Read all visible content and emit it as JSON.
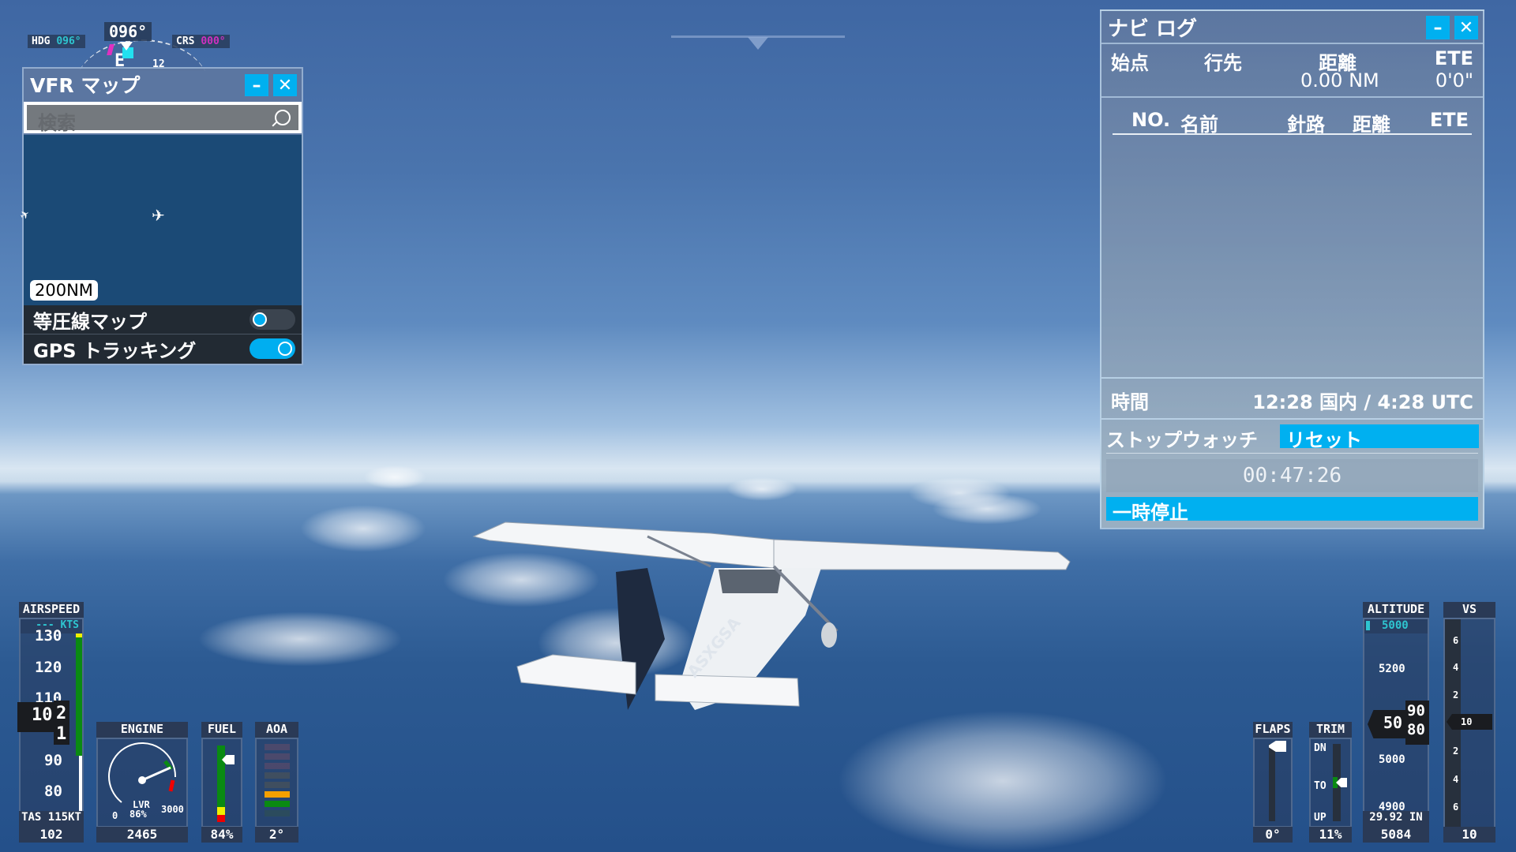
{
  "heading": {
    "hdg_label": "HDG",
    "hdg_value": "096°",
    "current": "096°",
    "crs_label": "CRS",
    "crs_value": "000°",
    "compass_letter": "E",
    "compass_num": "12"
  },
  "vfr_map": {
    "title": "VFR マップ",
    "minimize_icon": "–",
    "close_icon": "✕",
    "search_placeholder": "検索",
    "scale": "200NM",
    "toggles": [
      {
        "label": "等圧線マップ",
        "state": "off"
      },
      {
        "label": "GPS トラッキング",
        "state": "on"
      }
    ]
  },
  "nav_log": {
    "title": "ナビ ログ",
    "minimize_icon": "–",
    "close_icon": "✕",
    "summary": {
      "origin_label": "始点",
      "dest_label": "行先",
      "distance_label": "距離",
      "distance_value": "0.00 NM",
      "ete_label": "ETE",
      "ete_value": "0'0\""
    },
    "columns": [
      "NO.",
      "名前",
      "針路",
      "距離",
      "ETE"
    ],
    "rows": [],
    "time_label": "時間",
    "time_value": "12:28 国内 / 4:28 UTC",
    "stopwatch_label": "ストップウォッチ",
    "reset_label": "リセット",
    "stopwatch_value": "00:47:26",
    "pause_label": "一時停止"
  },
  "aircraft": {
    "tail_number": "ASXGSA"
  },
  "airspeed": {
    "label": "AIRSPEED",
    "selected": "--- KTS",
    "ticks": [
      "130",
      "120",
      "110",
      "90",
      "80"
    ],
    "current_main": "10",
    "roll_up": "2",
    "roll_down": "1",
    "tas": "TAS 115KT",
    "value": "102"
  },
  "engine": {
    "label": "ENGINE",
    "min": "0",
    "max": "3000",
    "lever_label": "LVR",
    "lever_value": "86%",
    "rpm": 2465,
    "rpm_text": "2465"
  },
  "fuel": {
    "label": "FUEL",
    "percent": 84,
    "value": "84%"
  },
  "aoa": {
    "label": "AOA",
    "value": "2°"
  },
  "flaps": {
    "label": "FLAPS",
    "value": "0°"
  },
  "trim": {
    "label": "TRIM",
    "dn": "DN",
    "to": "TO",
    "up": "UP",
    "value": "11%"
  },
  "altitude": {
    "label": "ALTITUDE",
    "selected": "5000",
    "ticks": [
      "5200",
      "5000",
      "4900"
    ],
    "current_main": "50",
    "roll_up": "90",
    "roll_down": "80",
    "baro": "29.92 IN",
    "value": "5084"
  },
  "vs": {
    "label": "VS",
    "ticks": [
      "6",
      "4",
      "2",
      "2",
      "4",
      "6"
    ],
    "pointer": "10",
    "value": "10"
  }
}
